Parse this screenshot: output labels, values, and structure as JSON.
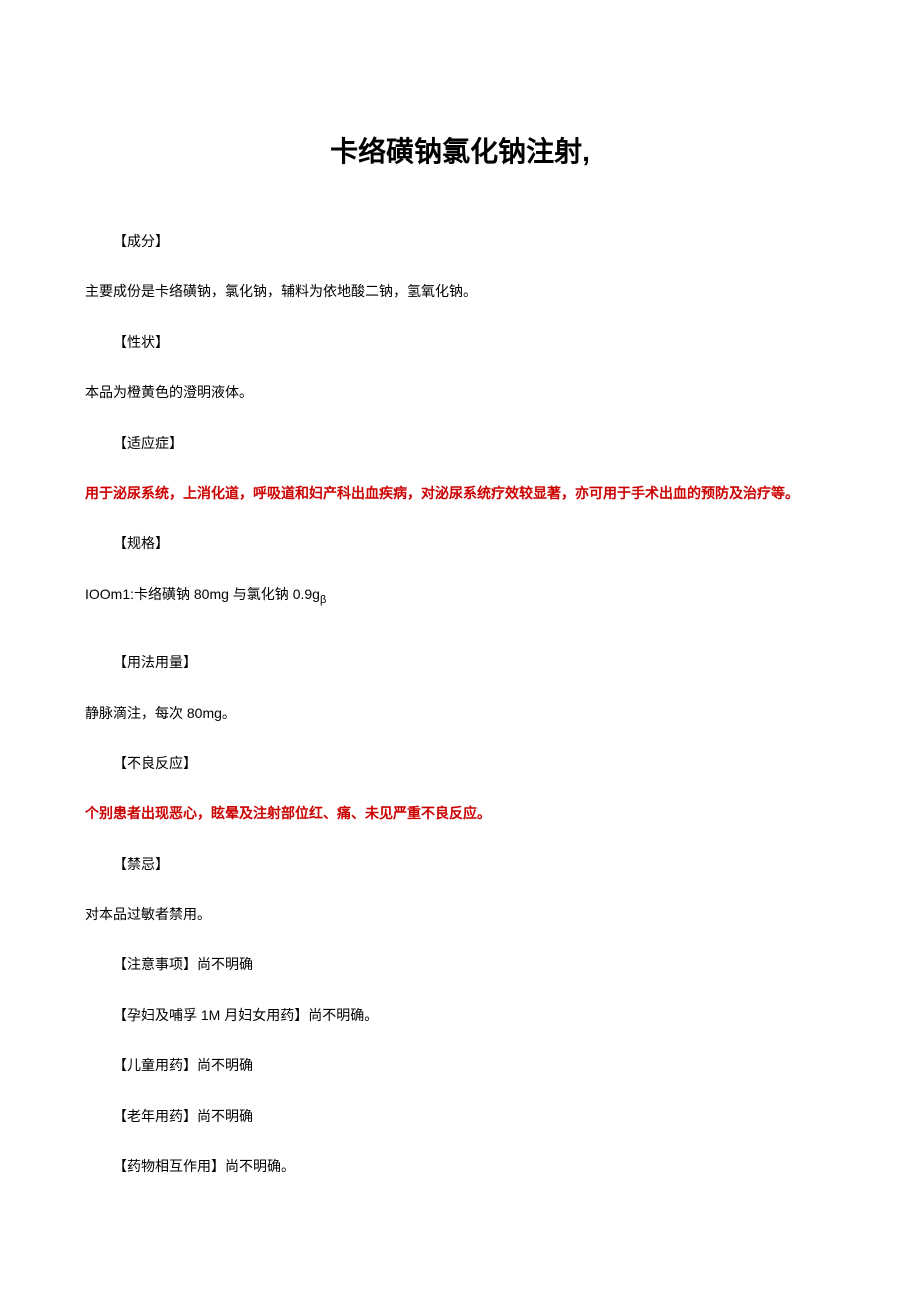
{
  "title": "卡络磺钠氯化钠注射,",
  "sections": {
    "composition": {
      "label": "【成分】",
      "text": "主要成份是卡络磺钠，氯化钠，辅料为依地酸二钠，氢氧化钠。"
    },
    "properties": {
      "label": "【性状】",
      "text": "本品为橙黄色的澄明液体。"
    },
    "indications": {
      "label": "【适应症】",
      "text": "用于泌尿系统，上消化道，呼吸道和妇产科出血疾病，对泌尿系统疗效较显著，亦可用于手术出血的预防及治疗等。"
    },
    "specification": {
      "label": "【规格】",
      "text_prefix": "IOOm1:卡络磺钠 80mg 与氯化钠 0.9g",
      "text_sub": "β"
    },
    "dosage": {
      "label": "【用法用量】",
      "text": "静脉滴注，每次 80mg。"
    },
    "adverse": {
      "label": "【不良反应】",
      "text": "个别患者出现恶心，眩晕及注射部位红、痛、未见严重不良反应。"
    },
    "contraindications": {
      "label": "【禁忌】",
      "text": "对本品过敏者禁用。"
    },
    "precautions": {
      "text": "【注意事项】尚不明确"
    },
    "pregnancy": {
      "text": "【孕妇及哺孚 1M 月妇女用药】尚不明确。"
    },
    "pediatric": {
      "text": "【儿童用药】尚不明确"
    },
    "geriatric": {
      "text": "【老年用药】尚不明确"
    },
    "interactions": {
      "text": "【药物相互作用】尚不明确。"
    }
  }
}
